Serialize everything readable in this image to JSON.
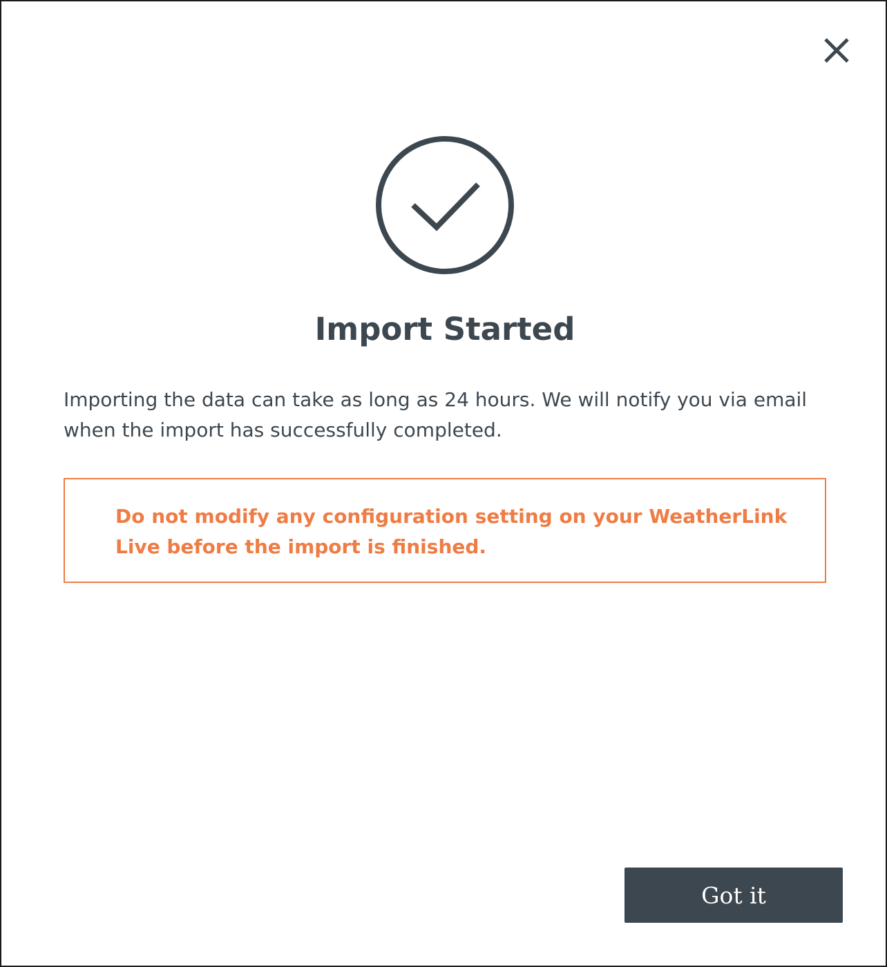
{
  "dialog": {
    "title": "Import Started",
    "description": "Importing the data can take as long as 24 hours. We will notify you via email when the import has successfully completed.",
    "warning": "Do not modify any configuration setting on your WeatherLink Live before the import is finished.",
    "confirm_label": "Got it",
    "close_icon": "close-icon",
    "status_icon": "check-circle-icon"
  },
  "colors": {
    "text": "#3d474f",
    "warning": "#ef7c44",
    "button_bg": "#3d474f",
    "button_text": "#ffffff",
    "border": "#1a1a1a"
  }
}
